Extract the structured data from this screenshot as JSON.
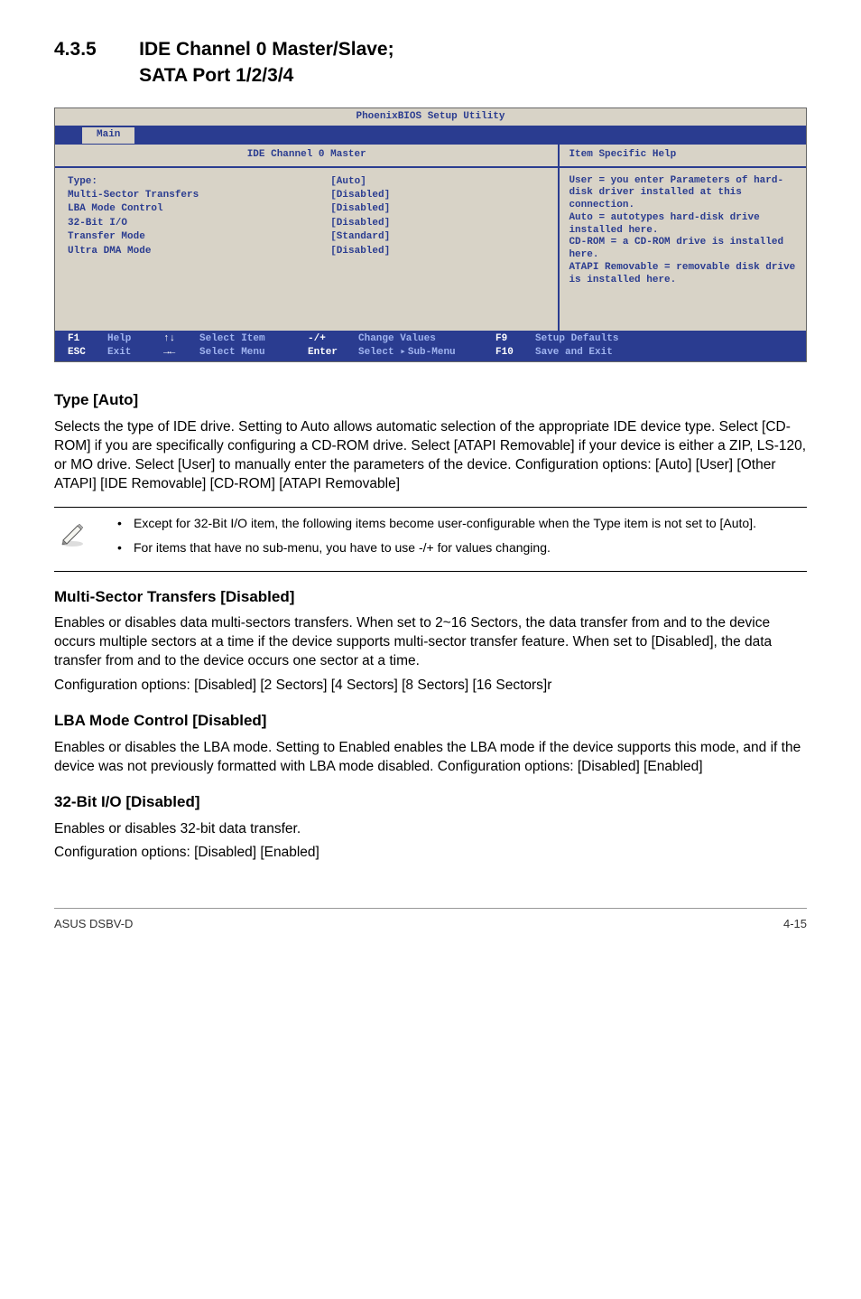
{
  "heading": {
    "number": "4.3.5",
    "title_line1": "IDE Channel 0 Master/Slave;",
    "title_line2": "SATA Port 1/2/3/4"
  },
  "bios": {
    "utility_title": "PhoenixBIOS Setup Utility",
    "tab": "Main",
    "left_header": "IDE Channel 0 Master",
    "right_header": "Item Specific Help",
    "rows": [
      {
        "label": "Type:",
        "value": "[Auto]"
      },
      {
        "label": "",
        "value": ""
      },
      {
        "label": "Multi-Sector Transfers",
        "value": "[Disabled]"
      },
      {
        "label": "LBA Mode Control",
        "value": "[Disabled]"
      },
      {
        "label": "32-Bit I/O",
        "value": "[Disabled]"
      },
      {
        "label": "Transfer Mode",
        "value": "[Standard]"
      },
      {
        "label": "Ultra DMA Mode",
        "value": "[Disabled]"
      }
    ],
    "help_text": "User = you enter Parameters of hard-disk driver installed at this connection.\nAuto = autotypes hard-disk drive installed here.\nCD-ROM = a CD-ROM drive is installed here.\nATAPI Removable = removable disk drive is installed here.",
    "footer": {
      "f1": "F1",
      "help": "Help",
      "updown": "↑↓",
      "select_item": "Select Item",
      "pm": "-/+",
      "change_values": "Change Values",
      "f9": "F9",
      "setup_defaults": "Setup Defaults",
      "esc": "ESC",
      "exit": "Exit",
      "lr": "→←",
      "select_menu": "Select Menu",
      "enter": "Enter",
      "select_sub": "Select",
      "sub_menu": "Sub-Menu",
      "f10": "F10",
      "save_exit": "Save and Exit"
    }
  },
  "sections": {
    "type": {
      "heading": "Type [Auto]",
      "body": "Selects the type of IDE drive. Setting to Auto allows automatic selection of the appropriate IDE device type. Select [CD-ROM] if you are specifically configuring a CD-ROM drive. Select [ATAPI Removable] if your device is either a ZIP, LS-120, or MO drive. Select [User] to manually enter the parameters of the device. Configuration options: [Auto] [User] [Other ATAPI] [IDE Removable] [CD-ROM] [ATAPI Removable]"
    },
    "notes": {
      "note1": "Except for 32-Bit I/O item, the following items become user-configurable when the Type item is not set to [Auto].",
      "note2": "For items that have no sub-menu, you have to use -/+ for values changing."
    },
    "multi": {
      "heading": "Multi-Sector Transfers [Disabled]",
      "body1": "Enables or disables data multi-sectors transfers. When set to 2~16 Sectors, the data transfer from and to the device occurs multiple sectors at a time if the device supports multi-sector transfer feature. When set to [Disabled], the data transfer from and to the device occurs one sector at a time.",
      "body2": "Configuration options: [Disabled] [2 Sectors] [4 Sectors] [8 Sectors] [16 Sectors]r"
    },
    "lba": {
      "heading": "LBA Mode Control [Disabled]",
      "body": "Enables or disables the LBA mode. Setting to Enabled enables the LBA mode if the device supports this mode, and if the device was not previously formatted with LBA mode disabled. Configuration options: [Disabled] [Enabled]"
    },
    "bit32": {
      "heading": "32-Bit I/O [Disabled]",
      "body1": "Enables or disables 32-bit data transfer.",
      "body2": "Configuration options: [Disabled] [Enabled]"
    }
  },
  "page_footer": {
    "left": "ASUS DSBV-D",
    "right": "4-15"
  }
}
